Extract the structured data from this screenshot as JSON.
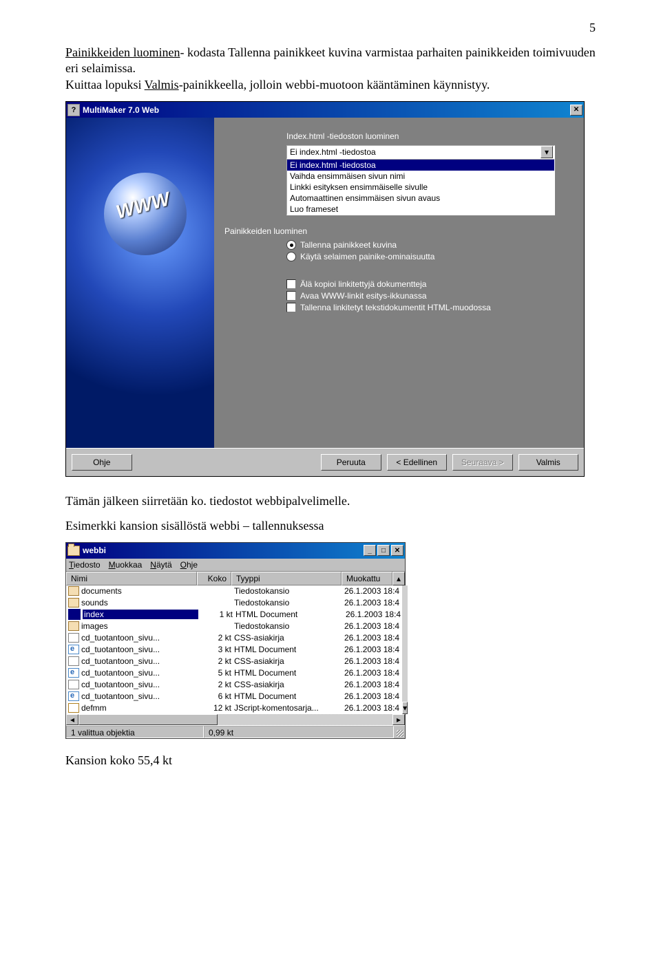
{
  "page_number": "5",
  "intro_text_parts": {
    "t1": "Painikkeiden luominen",
    "t2": "- kodasta Tallenna painikkeet kuvina varmistaa parhaiten painikkeiden toimivuuden eri selaimissa.",
    "t3": "Kuittaa lopuksi ",
    "t4": "Valmis",
    "t5": "-painikkeella, jolloin webbi-muotoon kääntäminen käynnistyy."
  },
  "dialog": {
    "title": "MultiMaker 7.0 Web",
    "section1_label": "Index.html -tiedoston luominen",
    "combo_value": "Ei index.html -tiedostoa",
    "list_items": [
      "Ei index.html -tiedostoa",
      "Vaihda ensimmäisen sivun nimi",
      "Linkki esityksen ensimmäiselle sivulle",
      "Automaattinen ensimmäisen sivun avaus",
      "Luo frameset"
    ],
    "section2_label": "Painikkeiden luominen",
    "radio1": "Tallenna painikkeet kuvina",
    "radio2": "Käytä selaimen painike-ominaisuutta",
    "check1": "Älä kopioi linkitettyjä dokumentteja",
    "check2": "Avaa WWW-linkit esitys-ikkunassa",
    "check3": "Tallenna linkitetyt tekstidokumentit HTML-muodossa",
    "buttons": {
      "help": "Ohje",
      "cancel": "Peruuta",
      "back": "< Edellinen",
      "next": "Seuraava >",
      "finish": "Valmis"
    }
  },
  "mid_text": "Tämän jälkeen siirretään ko. tiedostot webbipalvelimelle.",
  "example_text": "Esimerkki kansion sisällöstä webbi – tallennuksessa",
  "explorer": {
    "title": "webbi",
    "menus": {
      "file": "Tiedosto",
      "edit": "Muokkaa",
      "view": "Näytä",
      "help": "Ohje"
    },
    "headers": {
      "name": "Nimi",
      "size": "Koko",
      "type": "Tyyppi",
      "mod": "Muokattu"
    },
    "rows": [
      {
        "icon": "folder",
        "name": "documents",
        "size": "",
        "type": "Tiedostokansio",
        "mod": "26.1.2003 18:4"
      },
      {
        "icon": "folder",
        "name": "sounds",
        "size": "",
        "type": "Tiedostokansio",
        "mod": "26.1.2003 18:4"
      },
      {
        "icon": "htmlsel",
        "name": "index",
        "size": "1 kt",
        "type": "HTML Document",
        "mod": "26.1.2003 18:4",
        "sel": true
      },
      {
        "icon": "folder",
        "name": "images",
        "size": "",
        "type": "Tiedostokansio",
        "mod": "26.1.2003 18:4"
      },
      {
        "icon": "css",
        "name": "cd_tuotantoon_sivu...",
        "size": "2 kt",
        "type": "CSS-asiakirja",
        "mod": "26.1.2003 18:4"
      },
      {
        "icon": "html",
        "name": "cd_tuotantoon_sivu...",
        "size": "3 kt",
        "type": "HTML Document",
        "mod": "26.1.2003 18:4"
      },
      {
        "icon": "css",
        "name": "cd_tuotantoon_sivu...",
        "size": "2 kt",
        "type": "CSS-asiakirja",
        "mod": "26.1.2003 18:4"
      },
      {
        "icon": "html",
        "name": "cd_tuotantoon_sivu...",
        "size": "5 kt",
        "type": "HTML Document",
        "mod": "26.1.2003 18:4"
      },
      {
        "icon": "css",
        "name": "cd_tuotantoon_sivu...",
        "size": "2 kt",
        "type": "CSS-asiakirja",
        "mod": "26.1.2003 18:4"
      },
      {
        "icon": "html",
        "name": "cd_tuotantoon_sivu...",
        "size": "6 kt",
        "type": "HTML Document",
        "mod": "26.1.2003 18:4"
      },
      {
        "icon": "js",
        "name": "defmm",
        "size": "12 kt",
        "type": "JScript-komentosarja...",
        "mod": "26.1.2003 18:4"
      }
    ],
    "status": {
      "sel": "1 valittua objektia",
      "size": "0,99 kt"
    }
  },
  "footer": "Kansion koko 55,4 kt"
}
